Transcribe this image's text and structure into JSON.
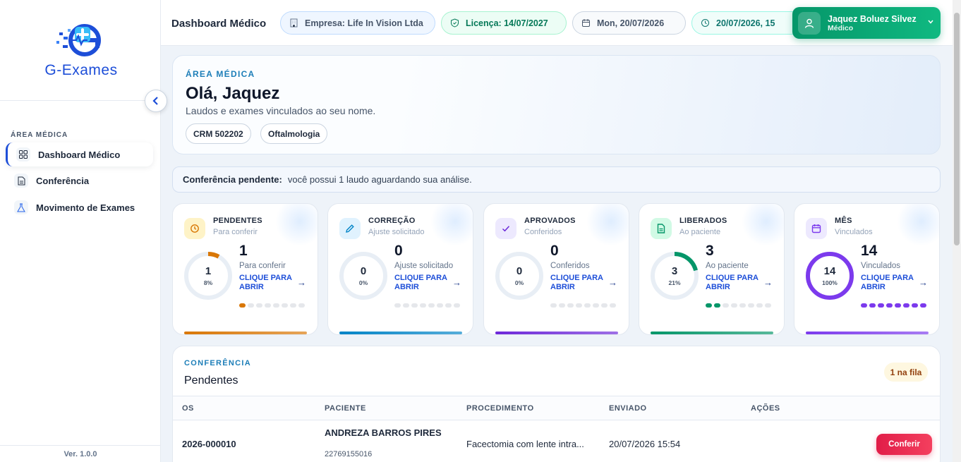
{
  "sidebar": {
    "logo_text": "G-Exames",
    "section_label": "ÁREA MÉDICA",
    "items": [
      {
        "label": "Dashboard Médico",
        "icon": "grid-icon",
        "active": true
      },
      {
        "label": "Conferência",
        "icon": "document-icon",
        "active": false
      },
      {
        "label": "Movimento de Exames",
        "icon": "flask-icon",
        "active": false
      }
    ],
    "version": "Ver. 1.0.0"
  },
  "header": {
    "title": "Dashboard Médico",
    "empresa": "Empresa: Life In Vision Ltda",
    "licenca": "Licença: 14/07/2027",
    "date": "Mon, 20/07/2026",
    "datetime": "20/07/2026, 15",
    "user": {
      "name": "Jaquez Boluez Silvez",
      "role": "Médico"
    }
  },
  "hero": {
    "eyebrow": "ÁREA MÉDICA",
    "title": "Olá, Jaquez",
    "subtitle": "Laudos e exames vinculados ao seu nome.",
    "tags": [
      "CRM 502202",
      "Oftalmologia"
    ]
  },
  "alert": {
    "title": "Conferência pendente:",
    "text": "você possui 1 laudo aguardando sua análise."
  },
  "cards": [
    {
      "title": "PENDENTES",
      "subtitle": "Para conferir",
      "value": "1",
      "percent": "8%",
      "fraction": 0.08,
      "label": "Para conferir",
      "link": "CLIQUE PARA ABRIR",
      "active_dots": 1,
      "color": "#d97706",
      "icon_bg": "#fef3c7",
      "icon": "clock-icon"
    },
    {
      "title": "CORREÇÃO",
      "subtitle": "Ajuste solicitado",
      "value": "0",
      "percent": "0%",
      "fraction": 0,
      "label": "Ajuste solicitado",
      "link": "CLIQUE PARA ABRIR",
      "active_dots": 0,
      "color": "#0284c7",
      "icon_bg": "#e0f2fe",
      "icon": "pencil-icon"
    },
    {
      "title": "APROVADOS",
      "subtitle": "Conferidos",
      "value": "0",
      "percent": "0%",
      "fraction": 0,
      "label": "Conferidos",
      "link": "CLIQUE PARA ABRIR",
      "active_dots": 0,
      "color": "#6d28d9",
      "icon_bg": "#ede9fe",
      "icon": "check-icon"
    },
    {
      "title": "LIBERADOS",
      "subtitle": "Ao paciente",
      "value": "3",
      "percent": "21%",
      "fraction": 0.21,
      "label": "Ao paciente",
      "link": "CLIQUE PARA ABRIR",
      "active_dots": 2,
      "color": "#059669",
      "icon_bg": "#d1fae5",
      "icon": "document-icon"
    },
    {
      "title": "MÊS",
      "subtitle": "Vinculados",
      "value": "14",
      "percent": "100%",
      "fraction": 1,
      "label": "Vinculados",
      "link": "CLIQUE PARA ABRIR",
      "active_dots": 8,
      "color": "#7c3aed",
      "icon_bg": "#ede9fe",
      "icon": "calendar-icon"
    }
  ],
  "conference": {
    "eyebrow": "CONFERÊNCIA",
    "title": "Pendentes",
    "queue_badge": "1 na fila",
    "columns": [
      "OS",
      "PACIENTE",
      "PROCEDIMENTO",
      "ENVIADO",
      "AÇÕES"
    ],
    "rows": [
      {
        "os": "2026-000010",
        "patient": "ANDREZA BARROS PIRES",
        "patient_id": "22769155016",
        "procedure": "Facectomia com lente intra...",
        "sent": "20/07/2026 15:54",
        "action": "Conferir"
      }
    ]
  }
}
